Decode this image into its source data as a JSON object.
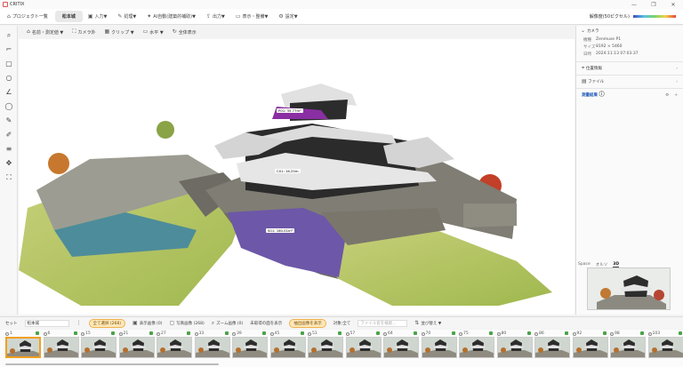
{
  "app": {
    "title": "CRITIX",
    "window_controls": [
      "—",
      "❐",
      "✕"
    ]
  },
  "nav": {
    "project_list": "プロジェクト一覧",
    "current_tab": "松本城",
    "menus": [
      {
        "icon": "import-icon",
        "label": "入力▼"
      },
      {
        "icon": "process-icon",
        "label": "処理▼"
      },
      {
        "icon": "ai-icon",
        "label": "AI自動(建築的補助)▼"
      },
      {
        "icon": "export-icon",
        "label": "出力▼"
      },
      {
        "icon": "display-icon",
        "label": "表示・整備▼"
      },
      {
        "icon": "gear-icon",
        "label": "設定▼"
      }
    ],
    "resolution_label": "解像度(50ピクセル)"
  },
  "toolbar": {
    "items": [
      "名前・測定値 ▼",
      "カメラ外",
      "クリップ ▼",
      "水平 ▼",
      "全体表示"
    ]
  },
  "right_panel": {
    "camera_head": "カメラ",
    "kv": [
      {
        "k": "機種",
        "v": "Zenmuse P1"
      },
      {
        "k": "サイズ",
        "v": "8192 × 5460"
      },
      {
        "k": "日時",
        "v": "2024:11:13 07:03:37"
      }
    ],
    "rows": [
      "位置情報",
      "ファイル"
    ],
    "section": "測量結果",
    "view_tabs": [
      "Space",
      "オルソ",
      "3D"
    ]
  },
  "measurements": {
    "top": "P01: 35.77m²",
    "mid": "C01: 16.25m",
    "base": "S01: 160.01m²"
  },
  "bottom": {
    "set_label": "セット",
    "set_value": "松本城",
    "pill_selected": "全て選択 (268)",
    "items": [
      "表示画像 (0)",
      "写真画像 (268)",
      "ズーム画像 (0)",
      "未取得の面を表示",
      "抽出画像を表示",
      "対象:全て"
    ],
    "search_placeholder": "ファイル名を検索...",
    "sort": "並び替え ▼"
  },
  "thumbs": [
    {
      "n": "1"
    },
    {
      "n": "6"
    },
    {
      "n": "15"
    },
    {
      "n": "21"
    },
    {
      "n": "27"
    },
    {
      "n": "33"
    },
    {
      "n": "39"
    },
    {
      "n": "45"
    },
    {
      "n": "51"
    },
    {
      "n": "57"
    },
    {
      "n": "64"
    },
    {
      "n": "70"
    },
    {
      "n": "75"
    },
    {
      "n": "80"
    },
    {
      "n": "86"
    },
    {
      "n": "92"
    },
    {
      "n": "98"
    },
    {
      "n": "103"
    }
  ]
}
